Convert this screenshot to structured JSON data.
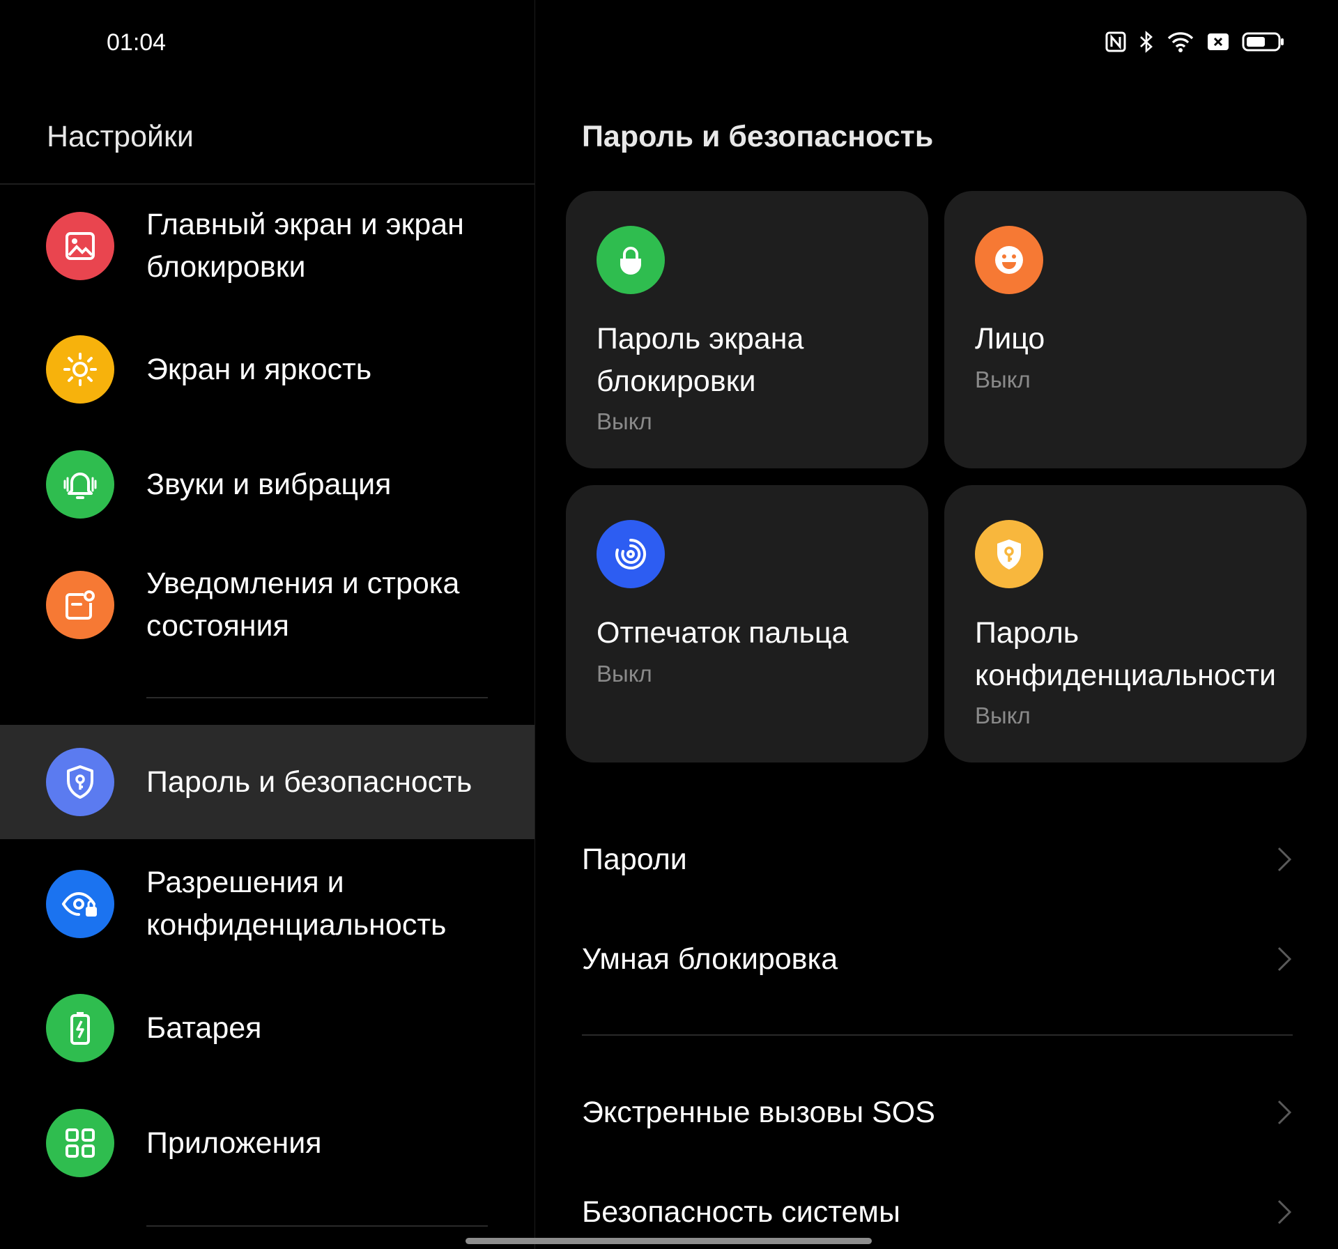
{
  "status_bar": {
    "time": "01:04",
    "icons": [
      "nfc-icon",
      "bluetooth-icon",
      "wifi-icon",
      "sim-off-icon",
      "battery-icon"
    ]
  },
  "sidebar": {
    "title": "Настройки",
    "items": [
      {
        "label": "Главный экран и экран блокировки",
        "icon": "wallpaper-icon",
        "color": "#e9454f"
      },
      {
        "label": "Экран и яркость",
        "icon": "brightness-icon",
        "color": "#f7b20c"
      },
      {
        "label": "Звуки и вибрация",
        "icon": "bell-icon",
        "color": "#2fbd4f"
      },
      {
        "label": "Уведомления и строка состояния",
        "icon": "notification-icon",
        "color": "#f67934"
      },
      {
        "label": "Пароль и безопасность",
        "icon": "shield-key-icon",
        "color": "#5b7bf0",
        "selected": true
      },
      {
        "label": "Разрешения и конфиденциальность",
        "icon": "eye-lock-icon",
        "color": "#1b73f0"
      },
      {
        "label": "Батарея",
        "icon": "battery-charge-icon",
        "color": "#2fbd4f"
      },
      {
        "label": "Приложения",
        "icon": "apps-grid-icon",
        "color": "#2fbd4f"
      }
    ]
  },
  "main": {
    "title": "Пароль и безопасность",
    "cards": [
      {
        "title": "Пароль экрана блокировки",
        "status": "Выкл",
        "icon": "lock-icon",
        "color": "#2fbd4f"
      },
      {
        "title": "Лицо",
        "status": "Выкл",
        "icon": "face-icon",
        "color": "#f67934"
      },
      {
        "title": "Отпечаток пальца",
        "status": "Выкл",
        "icon": "fingerprint-icon",
        "color": "#2d5df2"
      },
      {
        "title": "Пароль конфиденциальности",
        "status": "Выкл",
        "icon": "privacy-key-icon",
        "color": "#f8b73d"
      }
    ],
    "rows": [
      {
        "label": "Пароли"
      },
      {
        "label": "Умная блокировка"
      },
      {
        "label": "Экстренные вызовы SOS"
      },
      {
        "label": "Безопасность системы"
      }
    ]
  }
}
